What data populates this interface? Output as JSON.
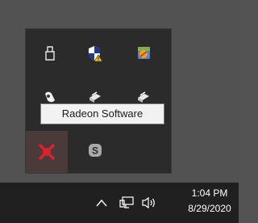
{
  "tooltip": {
    "text": "Radeon Software"
  },
  "flyout": {
    "items": [
      {
        "name": "usb-eject-icon"
      },
      {
        "name": "windows-security-shield-icon"
      },
      {
        "name": "colorful-app-icon"
      },
      {
        "name": "bluetooth-device-icon"
      },
      {
        "name": "network-app-icon"
      },
      {
        "name": "network-app-icon-2"
      },
      {
        "name": "radeon-software-icon"
      },
      {
        "name": "skype-icon"
      }
    ]
  },
  "taskbar": {
    "time": "1:04 PM",
    "date": "8/29/2020",
    "icons": [
      "show-hidden-icons-chevron-icon",
      "network-icon",
      "volume-icon"
    ]
  },
  "colors": {
    "taskbar_bg": "#202020",
    "flyout_bg": "#2b2b2b",
    "radeon_red": "#e0202e",
    "tooltip_bg": "#f2f2f2"
  }
}
